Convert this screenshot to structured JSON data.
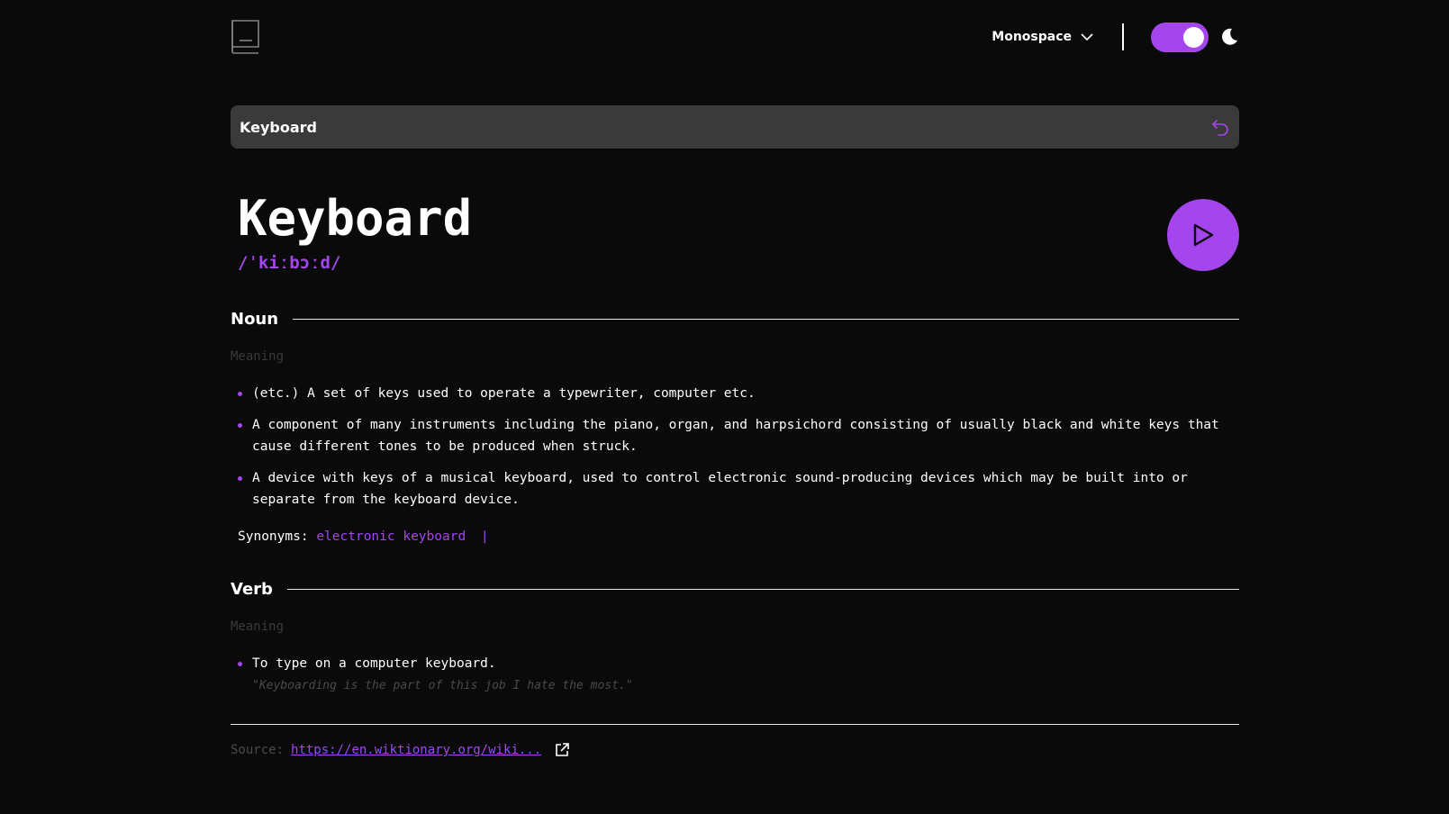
{
  "header": {
    "font_label": "Monospace",
    "theme": "dark"
  },
  "search": {
    "value": "Keyboard"
  },
  "word": {
    "title": "Keyboard",
    "phonetic": "/ˈkiːbɔːd/"
  },
  "noun": {
    "label": "Noun",
    "meaning_label": "Meaning",
    "definitions": [
      "(etc.) A set of keys used to operate a typewriter, computer etc.",
      "A component of many instruments including the piano, organ, and harpsichord consisting of usually black and white keys that cause different tones to be produced when struck.",
      "A device with keys of a musical keyboard, used to control electronic sound-producing devices which may be built into or separate from the keyboard device."
    ],
    "synonyms_label": "Synonyms:",
    "synonyms": [
      "electronic keyboard"
    ],
    "synonym_separator": "|"
  },
  "verb": {
    "label": "Verb",
    "meaning_label": "Meaning",
    "definitions": [
      "To type on a computer keyboard."
    ],
    "example": "\"Keyboarding is the part of this job I hate the most.\""
  },
  "source": {
    "label": "Source:",
    "url_text": "https://en.wiktionary.org/wiki..."
  },
  "colors": {
    "accent": "#a445ed",
    "background": "#0a0a0a",
    "search_bg": "#3a3a3a",
    "muted": "#4a4a4a"
  },
  "icons": {
    "logo": "book-icon",
    "dropdown": "chevron-down-icon",
    "theme": "moon-icon",
    "search": "undo-arrow-icon",
    "play": "play-icon",
    "external": "external-link-icon"
  }
}
